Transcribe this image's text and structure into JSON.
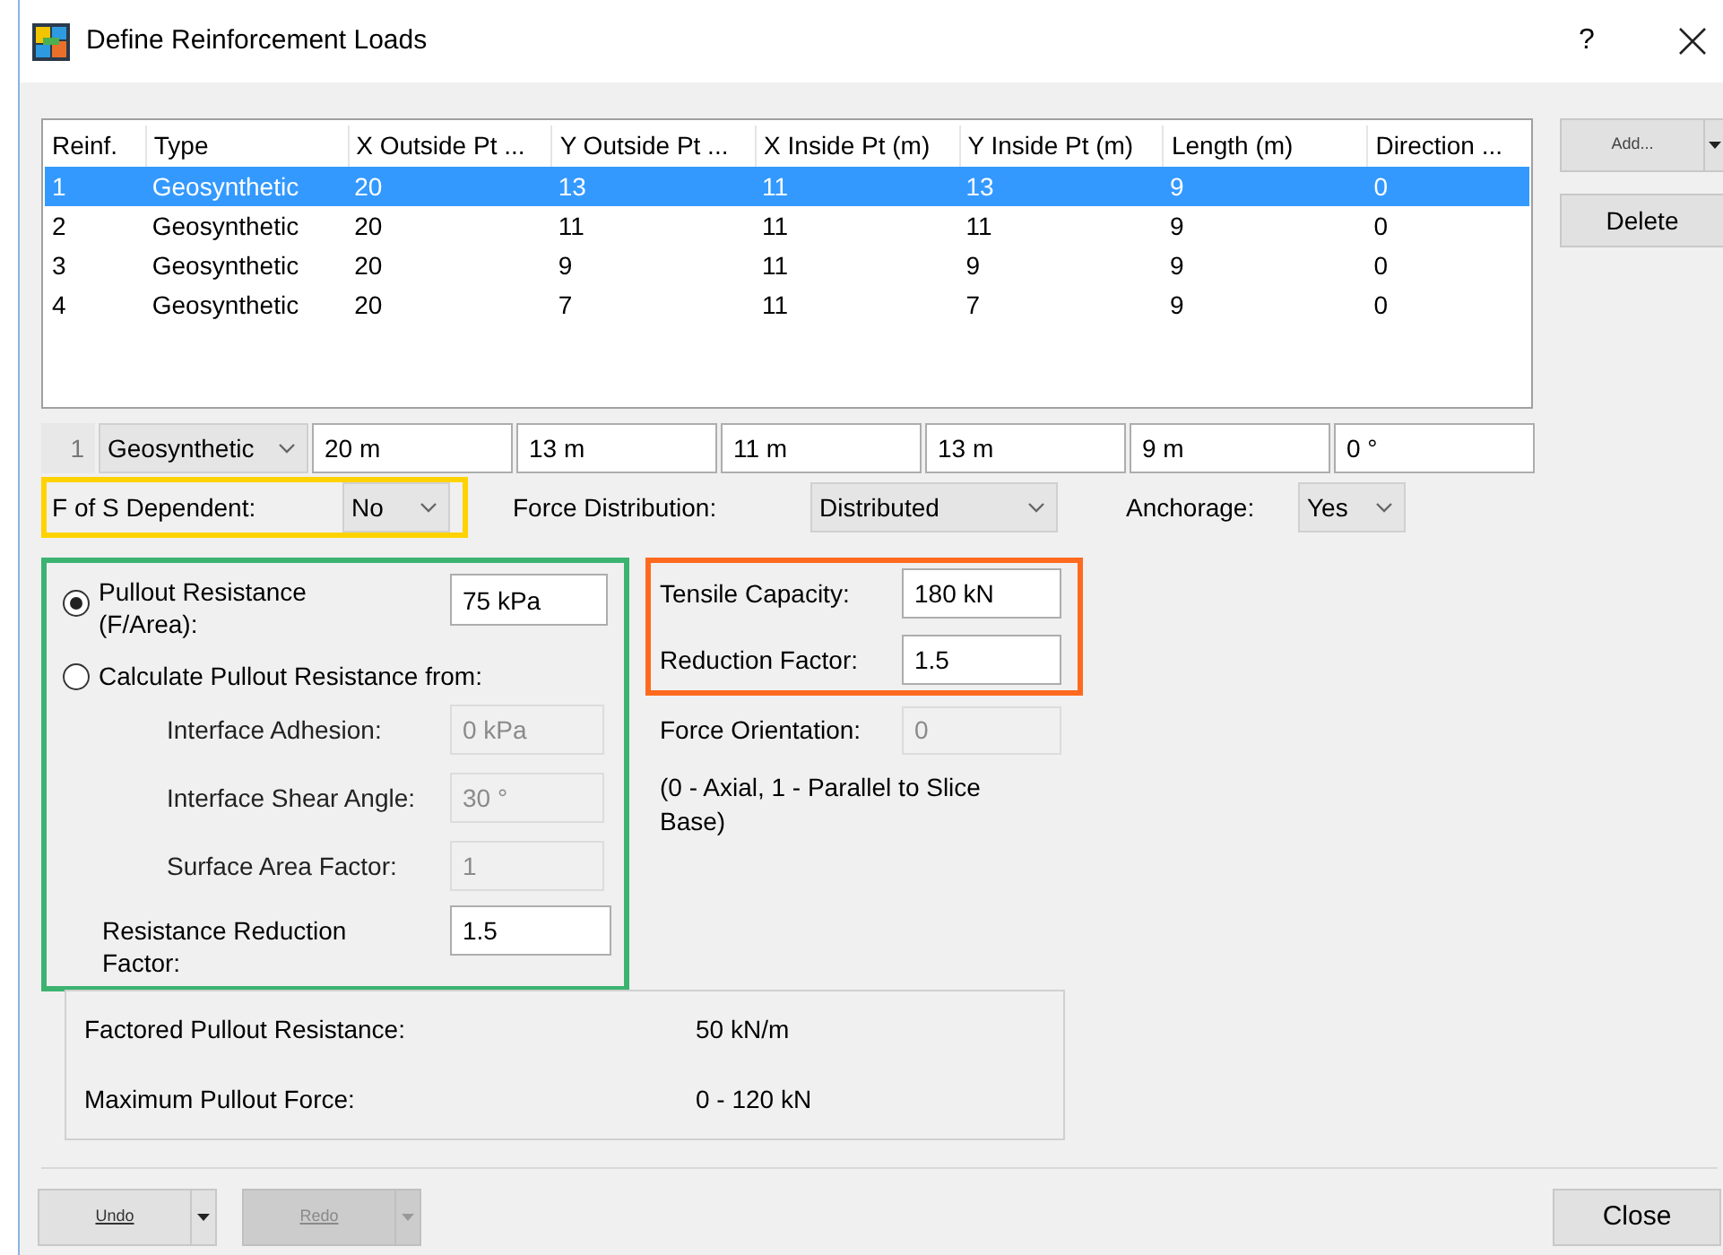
{
  "window": {
    "title": "Define Reinforcement Loads",
    "help": "?"
  },
  "table": {
    "columns": [
      "Reinf.",
      "Type",
      "X Outside Pt ...",
      "Y Outside Pt ...",
      "X Inside Pt (m)",
      "Y Inside Pt (m)",
      "Length (m)",
      "Direction ..."
    ],
    "rows": [
      {
        "selected": true,
        "cells": [
          "1",
          "Geosynthetic",
          "20",
          "13",
          "11",
          "13",
          "9",
          "0"
        ]
      },
      {
        "selected": false,
        "cells": [
          "2",
          "Geosynthetic",
          "20",
          "11",
          "11",
          "11",
          "9",
          "0"
        ]
      },
      {
        "selected": false,
        "cells": [
          "3",
          "Geosynthetic",
          "20",
          "9",
          "11",
          "9",
          "9",
          "0"
        ]
      },
      {
        "selected": false,
        "cells": [
          "4",
          "Geosynthetic",
          "20",
          "7",
          "11",
          "7",
          "9",
          "0"
        ]
      }
    ]
  },
  "side_buttons": {
    "add": {
      "label": "Add..."
    },
    "delete": {
      "label": "Delete"
    }
  },
  "editor": {
    "index": "1",
    "type": "Geosynthetic",
    "fields": [
      "20 m",
      "13 m",
      "11 m",
      "13 m",
      "9 m",
      "0 °"
    ]
  },
  "options": [
    {
      "label": "F of S Dependent:",
      "value": "No",
      "color": "#ffd200"
    },
    {
      "label": "Force Distribution:",
      "value": "Distributed"
    },
    {
      "label": "Anchorage:",
      "value": "Yes"
    }
  ],
  "pullout": {
    "color": "#3cb371",
    "choices": [
      {
        "label": "Pullout Resistance (F/Area):",
        "selected": true,
        "value": "75 kPa"
      },
      {
        "label": "Calculate Pullout Resistance from:",
        "selected": false
      }
    ],
    "fields": [
      {
        "label": "Interface Adhesion:",
        "value": "0 kPa",
        "disabled": true
      },
      {
        "label": "Interface Shear Angle:",
        "value": "30 °",
        "disabled": true
      },
      {
        "label": "Surface Area Factor:",
        "value": "1",
        "disabled": true
      }
    ],
    "reduction": {
      "label": "Resistance Reduction Factor:",
      "value": "1.5"
    }
  },
  "tensile": {
    "color": "#ff6a1f",
    "fields": [
      {
        "label": "Tensile Capacity:",
        "value": "180 kN"
      },
      {
        "label": "Reduction Factor:",
        "value": "1.5"
      }
    ]
  },
  "orientation": {
    "label": "Force Orientation:",
    "value": "0",
    "disabled": true,
    "note": "(0 - Axial, 1 - Parallel to Slice Base)"
  },
  "summary": [
    {
      "label": "Factored Pullout Resistance:",
      "value": "50 kN/m"
    },
    {
      "label": "Maximum Pullout Force:",
      "value": "0 - 120 kN"
    }
  ],
  "footer": {
    "undo": {
      "label": "Undo",
      "disabled": false
    },
    "redo": {
      "label": "Redo",
      "disabled": true
    },
    "close": {
      "label": "Close"
    }
  }
}
